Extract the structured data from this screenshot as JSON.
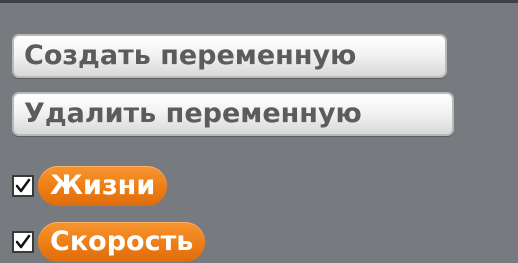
{
  "variables_panel": {
    "create_button_label": "Создать переменную",
    "delete_button_label": "Удалить переменную",
    "variables": [
      {
        "name": "Жизни",
        "checked": true
      },
      {
        "name": "Скорость",
        "checked": true
      }
    ]
  },
  "colors": {
    "panel_background": "#777a7f",
    "variable_block": "#ee7d16"
  }
}
